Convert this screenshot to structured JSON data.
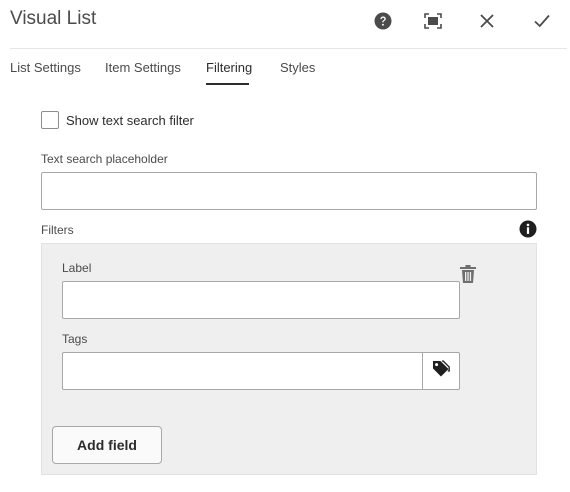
{
  "dialog": {
    "title": "Visual List",
    "header_icons": [
      "help-icon",
      "fullscreen-icon",
      "close-icon",
      "done-icon"
    ]
  },
  "tabs": [
    {
      "label": "List Settings",
      "active": false
    },
    {
      "label": "Item Settings",
      "active": false
    },
    {
      "label": "Filtering",
      "active": true
    },
    {
      "label": "Styles",
      "active": false
    }
  ],
  "filtering": {
    "show_search_label": "Show text search filter",
    "show_search_checked": false,
    "placeholder_label": "Text search placeholder",
    "placeholder_value": "",
    "filters_label": "Filters",
    "filter_item": {
      "label_field": "Label",
      "label_value": "",
      "tags_field": "Tags",
      "tags_value": ""
    },
    "add_field_label": "Add field"
  },
  "colors": {
    "text": "#2c2c2c",
    "panel_bg": "#efefef",
    "border": "#a8a8a8"
  }
}
